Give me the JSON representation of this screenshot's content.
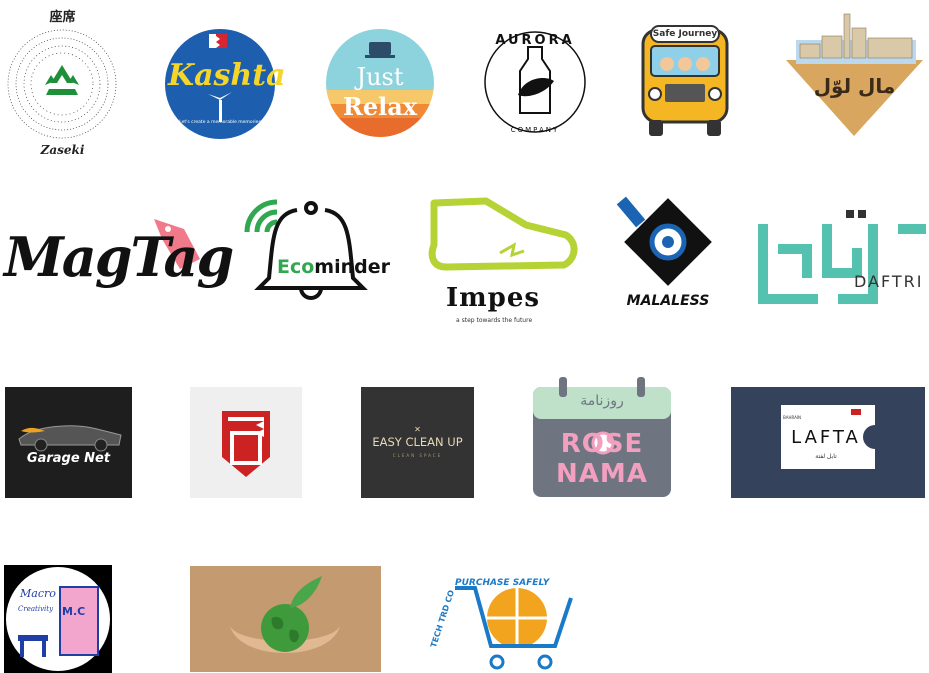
{
  "logos": [
    {
      "id": "zaseki",
      "texts": {
        "top": "座席",
        "bottom": "Zaseki"
      },
      "colors": {
        "green": "#1f8f3a",
        "ink": "#222222"
      }
    },
    {
      "id": "kashta",
      "texts": {
        "name": "Kashta",
        "tagline": "Let's create a memorable memories"
      },
      "colors": {
        "blue": "#1d5fae",
        "yellow": "#f5d52a",
        "red": "#d62631"
      }
    },
    {
      "id": "just-relax",
      "texts": {
        "line1": "Just",
        "line2": "Relax"
      },
      "colors": {
        "sky": "#8dd3de",
        "orange": "#f08a35"
      }
    },
    {
      "id": "aurora",
      "texts": {
        "name": "AURORA",
        "sub": "COMPANY"
      },
      "colors": {
        "ink": "#111111"
      }
    },
    {
      "id": "safe-journey",
      "texts": {
        "banner": "Safe Journey"
      },
      "colors": {
        "bus": "#f5b623",
        "ink": "#333333"
      }
    },
    {
      "id": "mal-lawal",
      "texts": {
        "arabic": "مال لوّل"
      },
      "colors": {
        "sand": "#d8a65e",
        "sky": "#bcd8ec"
      }
    },
    {
      "id": "magtag",
      "texts": {
        "name": "MagTag"
      },
      "colors": {
        "ink": "#111111",
        "pink": "#f07a8a"
      }
    },
    {
      "id": "ecominder",
      "texts": {
        "eco": "Eco",
        "minder": "minder"
      },
      "colors": {
        "green": "#2fa84f",
        "ink": "#111111"
      }
    },
    {
      "id": "impes",
      "texts": {
        "name": "Impes",
        "tagline": "a step towards the future"
      },
      "colors": {
        "lime": "#b5d334",
        "ink": "#111111"
      }
    },
    {
      "id": "malaless",
      "texts": {
        "name": "MALALESS"
      },
      "colors": {
        "blue": "#1b64b4",
        "ink": "#111111"
      }
    },
    {
      "id": "daftri",
      "texts": {
        "name": "DAFTRI"
      },
      "colors": {
        "teal": "#55c2b0",
        "ink": "#333333"
      }
    },
    {
      "id": "garage-net",
      "texts": {
        "name": "Garage Net"
      },
      "colors": {
        "bg": "#1e1e1e",
        "flame": "#f0a020"
      }
    },
    {
      "id": "bahrain-emblem",
      "texts": {},
      "colors": {
        "red": "#cc2222",
        "bg": "#efefef"
      }
    },
    {
      "id": "easy-clean-up",
      "texts": {
        "name": "EASY CLEAN UP",
        "sub": "CLEAN SPACE"
      },
      "colors": {
        "bg": "#333333",
        "text": "#e8d8b8"
      }
    },
    {
      "id": "rose-nama",
      "texts": {
        "arabic": "روزنامة",
        "name1": "ROSE",
        "name2": "NAMA"
      },
      "colors": {
        "mint": "#bfe0c9",
        "pink": "#f39fc0",
        "slate": "#6f7580"
      }
    },
    {
      "id": "lafta",
      "texts": {
        "small": "BAHRAIN",
        "name": "LAFTA",
        "arabic": "تابل لفتة"
      },
      "colors": {
        "bg": "#34425c",
        "card": "#ffffff"
      }
    },
    {
      "id": "macro-creativity",
      "texts": {
        "name": "Macro",
        "name2": "Creativity",
        "initials": "M.C"
      },
      "colors": {
        "pink": "#f2a6cd",
        "blue": "#1f3ea6"
      }
    },
    {
      "id": "globe-hands",
      "texts": {},
      "colors": {
        "bg": "#b08560",
        "globe": "#3f9a3b"
      }
    },
    {
      "id": "tech-trd",
      "texts": {
        "top": "PURCHASE SAFELY",
        "side": "TECH TRD CO"
      },
      "colors": {
        "orange": "#f3a41e",
        "blue": "#1a7ac7"
      }
    }
  ]
}
